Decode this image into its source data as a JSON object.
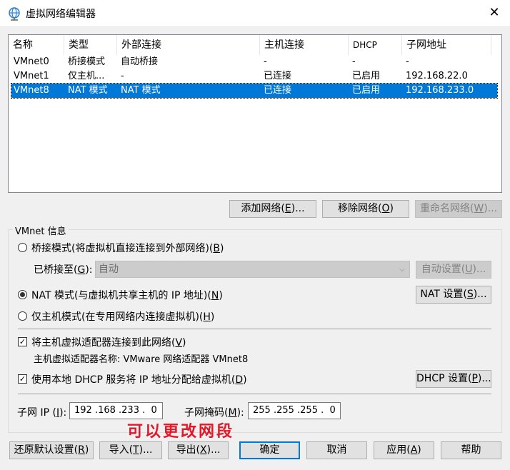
{
  "window": {
    "title": "虚拟网络编辑器",
    "close_symbol": "✕"
  },
  "table": {
    "columns": [
      "名称",
      "类型",
      "外部连接",
      "主机连接",
      "DHCP",
      "子网地址"
    ],
    "rows": [
      [
        "VMnet0",
        "桥接模式",
        "自动桥接",
        "-",
        "-",
        "-"
      ],
      [
        "VMnet1",
        "仅主机...",
        "-",
        "已连接",
        "已启用",
        "192.168.22.0"
      ],
      [
        "VMnet8",
        "NAT 模式",
        "NAT 模式",
        "已连接",
        "已启用",
        "192.168.233.0"
      ]
    ],
    "selected_row": 2
  },
  "list_buttons": {
    "add": {
      "label": "添加网络(",
      "key": "E",
      "suffix": ")..."
    },
    "remove": {
      "label": "移除网络(",
      "key": "O",
      "suffix": ")"
    },
    "rename": {
      "label": "重命名网络(",
      "key": "W",
      "suffix": ")..."
    }
  },
  "vmnet_info": {
    "title": "VMnet 信息",
    "bridge": {
      "label": "桥接模式(将虚拟机直接连接到外部网络)(",
      "key": "B",
      "suffix": ")"
    },
    "bridged_to": {
      "label": "已桥接至(",
      "key": "G",
      "suffix": "):",
      "value": "自动"
    },
    "auto_settings": {
      "label": "自动设置(",
      "key": "U",
      "suffix": ")..."
    },
    "nat": {
      "label": "NAT 模式(与虚拟机共享主机的 IP 地址)(",
      "key": "N",
      "suffix": ")"
    },
    "nat_settings": {
      "label": "NAT 设置(",
      "key": "S",
      "suffix": ")..."
    },
    "host_only": {
      "label": "仅主机模式(在专用网络内连接虚拟机)(",
      "key": "H",
      "suffix": ")"
    },
    "connect_adapter": {
      "label": "将主机虚拟适配器连接到此网络(",
      "key": "V",
      "suffix": ")",
      "checked": true
    },
    "adapter_name": "主机虚拟适配器名称: VMware 网络适配器 VMnet8",
    "use_dhcp": {
      "label": "使用本地 DHCP 服务将 IP 地址分配给虚拟机(",
      "key": "D",
      "suffix": ")",
      "checked": true
    },
    "dhcp_settings": {
      "label": "DHCP 设置(",
      "key": "P",
      "suffix": ")..."
    },
    "subnet_ip": {
      "label": "子网 IP (",
      "key": "I",
      "suffix": "):",
      "value": "192 .168 .233 .  0"
    },
    "subnet_mask": {
      "label": "子网掩码(",
      "key": "M",
      "suffix": "):",
      "value": "255 .255 .255 .  0"
    },
    "check_mark": "✓"
  },
  "annotation": "可以更改网段",
  "bottom_buttons": {
    "restore": {
      "label": "还原默认设置(",
      "key": "R",
      "suffix": ")"
    },
    "import": {
      "label": "导入(",
      "key": "T",
      "suffix": ")..."
    },
    "export": {
      "label": "导出(",
      "key": "X",
      "suffix": ")..."
    },
    "ok": {
      "label": "确定"
    },
    "cancel": {
      "label": "取消"
    },
    "apply": {
      "label": "应用(",
      "key": "A",
      "suffix": ")"
    },
    "help": {
      "label": "帮助"
    }
  },
  "colors": {
    "selection": "#0078d7",
    "annotation": "#e0182a"
  }
}
